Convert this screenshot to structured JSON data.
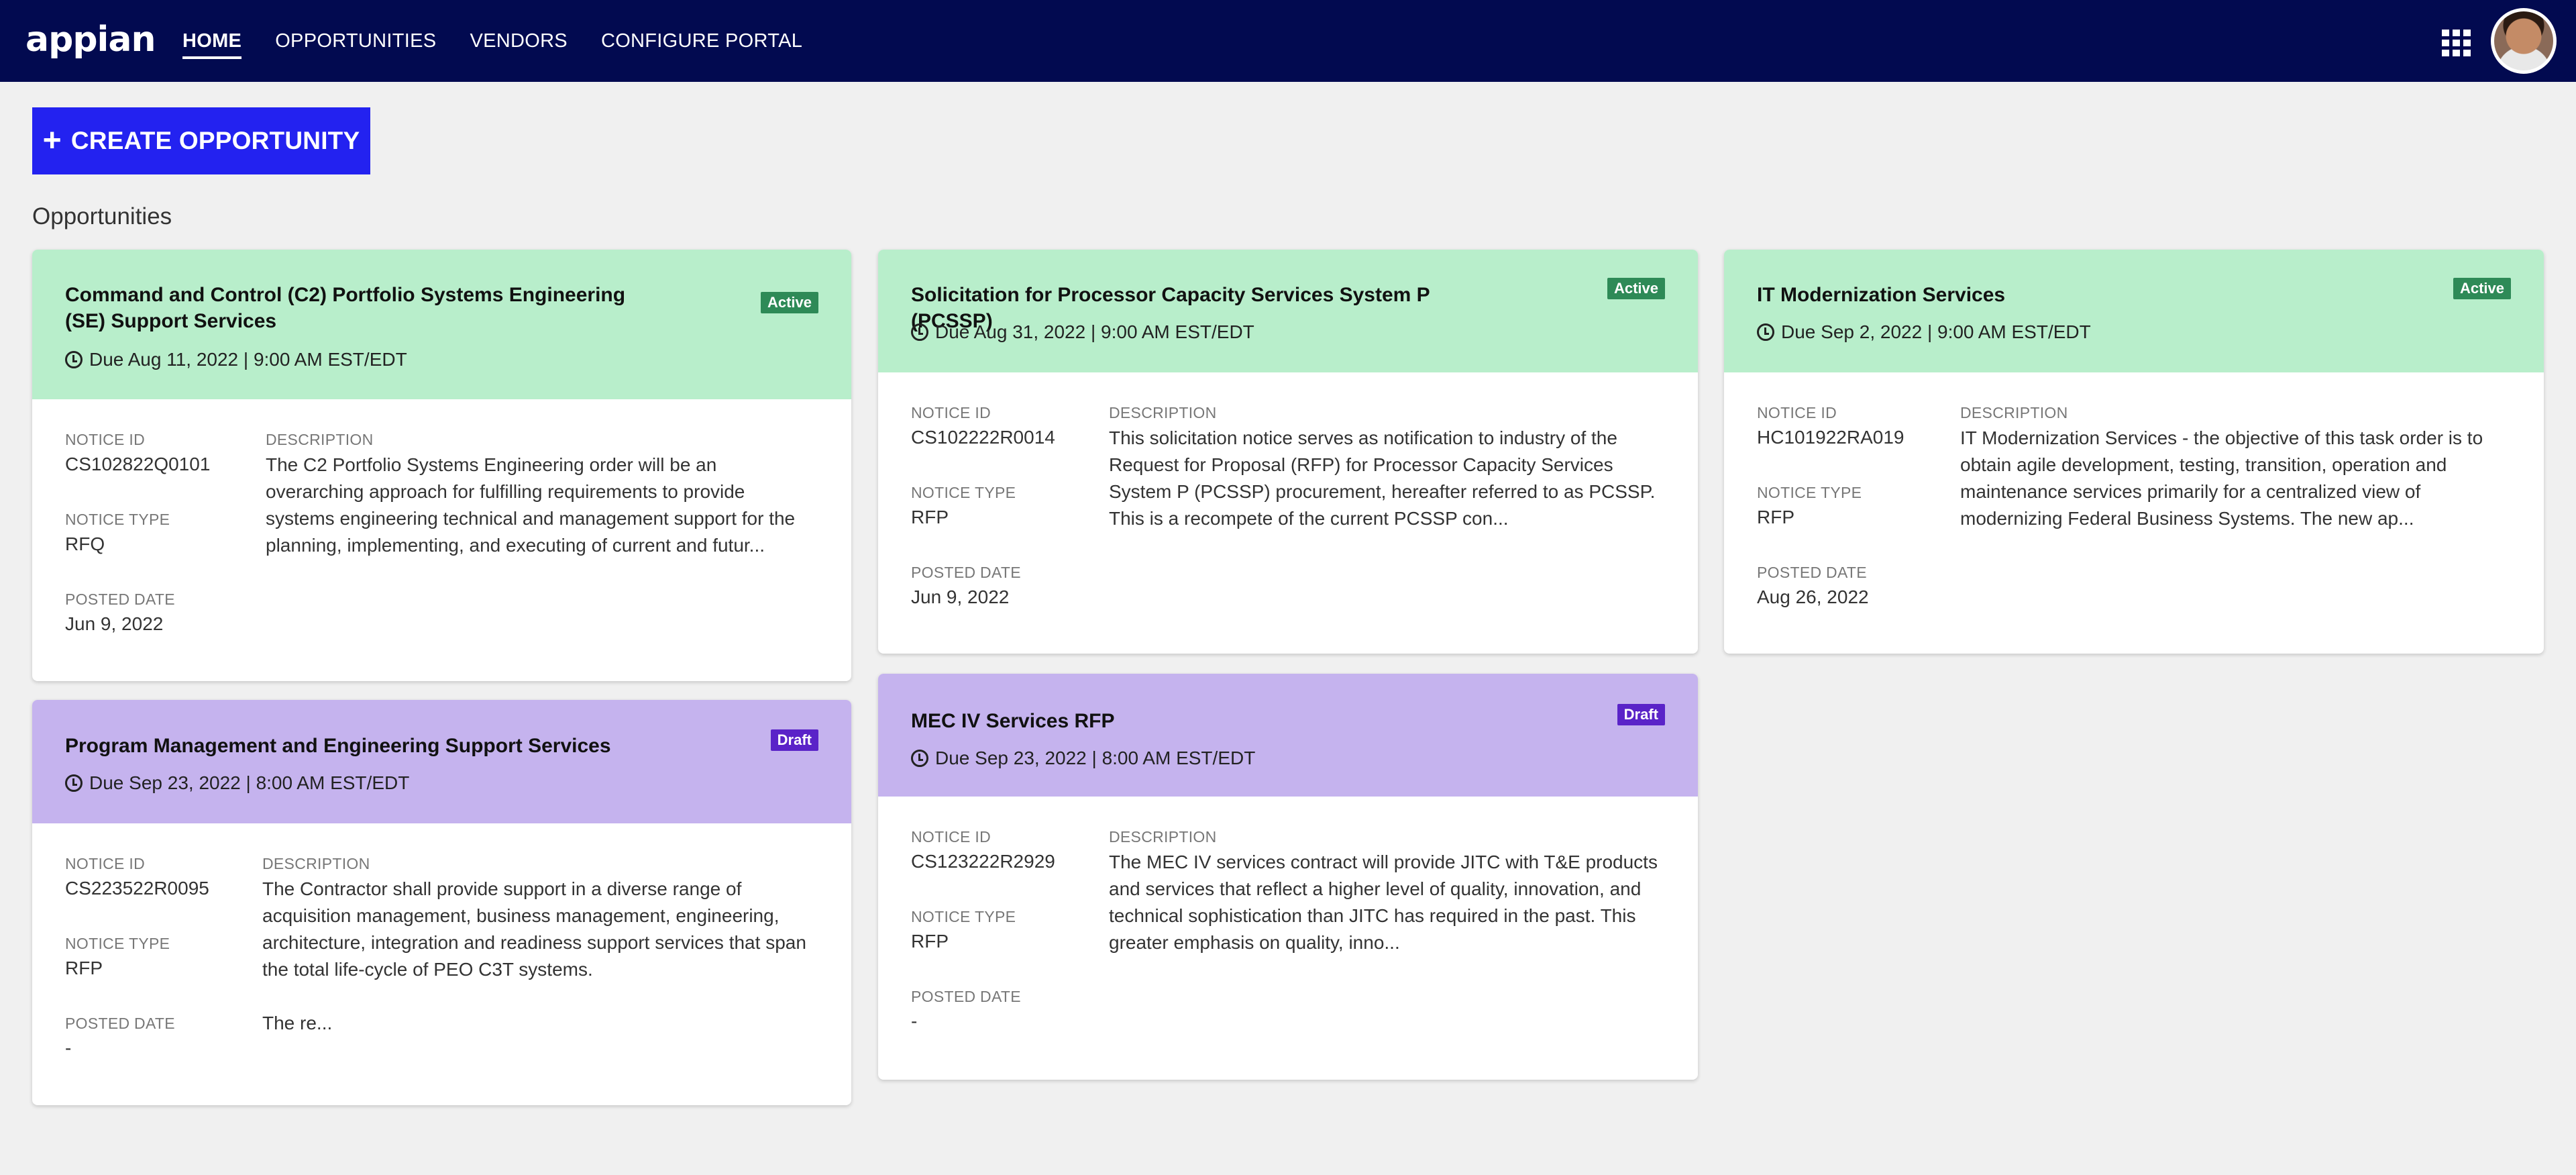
{
  "app": {
    "logo": "appian",
    "nav": [
      "HOME",
      "OPPORTUNITIES",
      "VENDORS",
      "CONFIGURE PORTAL"
    ],
    "active_nav": "HOME"
  },
  "actions": {
    "create": "CREATE OPPORTUNITY"
  },
  "section_title": "Opportunities",
  "labels": {
    "notice_id": "NOTICE ID",
    "description": "DESCRIPTION",
    "notice_type": "NOTICE TYPE",
    "posted_date": "POSTED DATE"
  },
  "cards": [
    {
      "title": "Command and Control (C2) Portfolio Systems Engineering (SE) Support Services",
      "status": "Active",
      "due": "Due Aug 11, 2022 | 9:00 AM EST/EDT",
      "notice_id": "CS102822Q0101",
      "notice_type": "RFQ",
      "posted_date": "Jun 9, 2022",
      "description": "The C2 Portfolio Systems Engineering order will be an overarching approach for fulfilling requirements to provide systems engineering technical and management support for the planning, implementing, and executing of current and futur..."
    },
    {
      "title": "Solicitation for Processor Capacity Services System P (PCSSP)",
      "status": "Active",
      "due": "Due Aug 31, 2022 | 9:00 AM EST/EDT",
      "notice_id": "CS102222R0014",
      "notice_type": "RFP",
      "posted_date": "Jun 9, 2022",
      "description": "This solicitation notice serves as notification to industry of the Request for Proposal (RFP) for Processor Capacity Services System P (PCSSP) procurement, hereafter referred to as PCSSP.  This is a recompete of the current PCSSP con..."
    },
    {
      "title": "IT Modernization Services",
      "status": "Active",
      "due": "Due Sep 2, 2022 | 9:00 AM EST/EDT",
      "notice_id": "HC101922RA019",
      "notice_type": "RFP",
      "posted_date": "Aug 26, 2022",
      "description": "IT Modernization Services - the objective of this task order is to obtain agile development, testing, transition, operation and maintenance services primarily for a centralized view of modernizing Federal Business Systems. The new ap..."
    },
    {
      "title": "Program Management and Engineering Support Services",
      "status": "Draft",
      "due": "Due Sep 23, 2022 | 8:00 AM EST/EDT",
      "notice_id": "CS223522R0095",
      "notice_type": "RFP",
      "posted_date": "-",
      "description": "The Contractor shall provide support in a diverse range of acquisition management, business management, engineering, architecture, integration and readiness support services that span the total life-cycle of PEO C3T systems.",
      "description_more": "The re..."
    },
    {
      "title": "MEC IV Services RFP",
      "status": "Draft",
      "due": "Due Sep 23, 2022 | 8:00 AM EST/EDT",
      "notice_id": "CS123222R2929",
      "notice_type": "RFP",
      "posted_date": "-",
      "description": "The MEC IV services contract will provide JITC with T&E products and services that reflect a higher level of quality, innovation, and technical sophistication than JITC has required in the past. This greater emphasis on quality, inno..."
    }
  ],
  "colors": {
    "header_bg": "#020a50",
    "primary_button": "#2322f0",
    "active_header": "#b8eecb",
    "draft_header": "#c5b3ee",
    "active_badge": "#2e8a57",
    "draft_badge": "#5a23c8",
    "page_bg": "#f0f0f0"
  }
}
